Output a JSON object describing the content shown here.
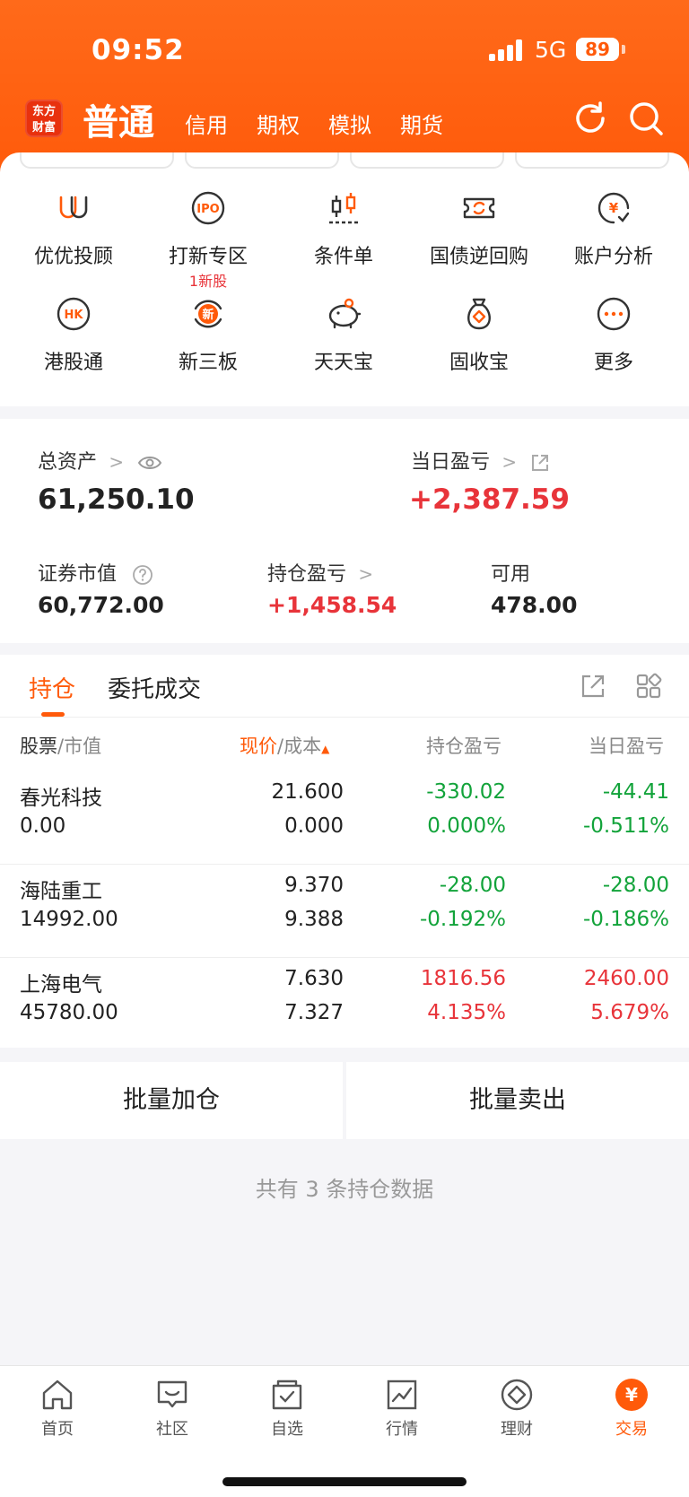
{
  "status_bar": {
    "time": "09:52",
    "network": "5G",
    "battery": "89"
  },
  "header": {
    "logo_line1": "东方",
    "logo_line2": "财富",
    "main_tab": "普通",
    "tabs": [
      "信用",
      "期权",
      "模拟",
      "期货"
    ],
    "refresh_icon": "refresh-icon",
    "search_icon": "search-icon"
  },
  "menu": {
    "items": [
      {
        "label": "优优投顾",
        "icon": "youyou-advisor-icon"
      },
      {
        "label": "打新专区",
        "icon": "ipo-icon",
        "sub": "1新股"
      },
      {
        "label": "条件单",
        "icon": "candlestick-icon"
      },
      {
        "label": "国债逆回购",
        "icon": "bond-repo-icon"
      },
      {
        "label": "账户分析",
        "icon": "account-analysis-icon"
      },
      {
        "label": "港股通",
        "icon": "hk-icon"
      },
      {
        "label": "新三板",
        "icon": "new-third-board-icon"
      },
      {
        "label": "天天宝",
        "icon": "piggy-bank-icon"
      },
      {
        "label": "固收宝",
        "icon": "money-bag-icon"
      },
      {
        "label": "更多",
        "icon": "more-icon"
      }
    ],
    "ipo_badge": "IPO",
    "hk_badge": "HK",
    "xin_badge": "新",
    "yen_badge": "¥"
  },
  "assets": {
    "total_label": "总资产",
    "total_value": "61,250.10",
    "daily_pl_label": "当日盈亏",
    "daily_pl_value": "+2,387.59",
    "market_value_label": "证券市值",
    "market_value": "60,772.00",
    "position_pl_label": "持仓盈亏",
    "position_pl_value": "+1,458.54",
    "available_label": "可用",
    "available_value": "478.00"
  },
  "positions": {
    "tabs": [
      "持仓",
      "委托成交"
    ],
    "columns": {
      "stock": "股票",
      "market_value": "市值",
      "price": "现价",
      "cost": "成本",
      "position_pl": "持仓盈亏",
      "daily_pl": "当日盈亏"
    },
    "rows": [
      {
        "name": "春光科技",
        "value": "0.00",
        "price": "21.600",
        "cost": "0.000",
        "pl": "-330.02",
        "pl_pct": "0.000%",
        "day": "-44.41",
        "day_pct": "-0.511%"
      },
      {
        "name": "海陆重工",
        "value": "14992.00",
        "price": "9.370",
        "cost": "9.388",
        "pl": "-28.00",
        "pl_pct": "-0.192%",
        "day": "-28.00",
        "day_pct": "-0.186%"
      },
      {
        "name": "上海电气",
        "value": "45780.00",
        "price": "7.630",
        "cost": "7.327",
        "pl": "1816.56",
        "pl_pct": "4.135%",
        "day": "2460.00",
        "day_pct": "5.679%"
      }
    ],
    "batch_add": "批量加仓",
    "batch_sell": "批量卖出",
    "summary": "共有 3 条持仓数据"
  },
  "bottom_nav": [
    {
      "label": "首页",
      "icon": "home-icon"
    },
    {
      "label": "社区",
      "icon": "community-icon"
    },
    {
      "label": "自选",
      "icon": "watchlist-icon"
    },
    {
      "label": "行情",
      "icon": "market-icon"
    },
    {
      "label": "理财",
      "icon": "wealth-icon"
    },
    {
      "label": "交易",
      "icon": "trade-icon"
    }
  ],
  "colors": {
    "brand": "#ff5a0a",
    "up": "#e8343a",
    "down": "#12a33a"
  }
}
